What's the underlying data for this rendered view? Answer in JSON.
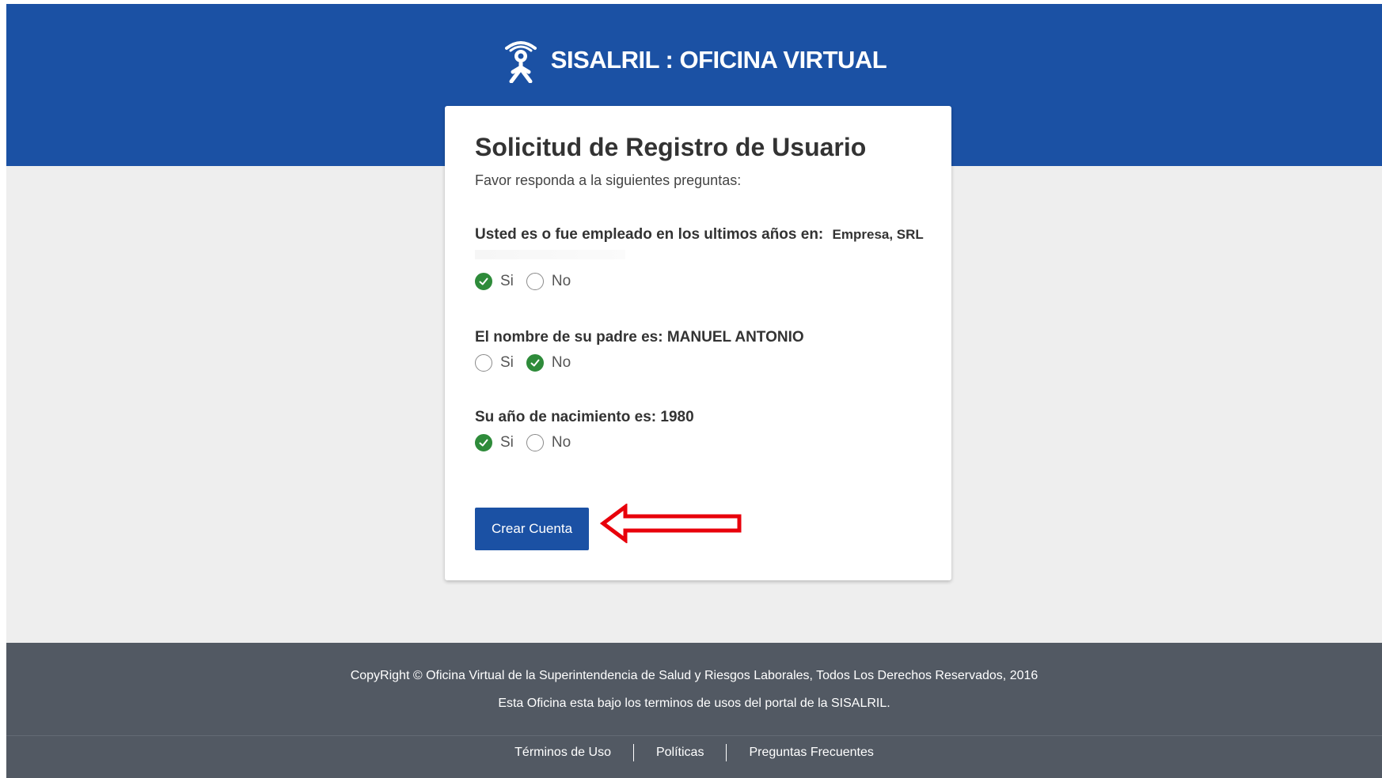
{
  "header": {
    "title": "SISALRIL : OFICINA VIRTUAL",
    "logo_icon": "person-icon",
    "background_color": "#1b51a4"
  },
  "card": {
    "title": "Solicitud de Registro de Usuario",
    "subtitle": "Favor responda a la siguientes preguntas:",
    "questions": [
      {
        "text": "Usted es o fue empleado en los ultimos años en:",
        "value": "Empresa, SRL",
        "options": [
          {
            "label": "Si",
            "checked": true
          },
          {
            "label": "No",
            "checked": false
          }
        ]
      },
      {
        "text": "El nombre de su padre es:",
        "value": "MANUEL ANTONIO",
        "options": [
          {
            "label": "Si",
            "checked": false
          },
          {
            "label": "No",
            "checked": true
          }
        ]
      },
      {
        "text": "Su año de nacimiento es:",
        "value": "1980",
        "options": [
          {
            "label": "Si",
            "checked": true
          },
          {
            "label": "No",
            "checked": false
          }
        ]
      }
    ],
    "submit_label": "Crear Cuenta",
    "check_color": "#2e8b3a"
  },
  "annotation": {
    "arrow_icon": "red-arrow-left-icon",
    "color": "#e8000b"
  },
  "footer": {
    "copyright": "CopyRight © Oficina Virtual de la Superintendencia de Salud y Riesgos Laborales, Todos Los Derechos Reservados, 2016",
    "terms_note": "Esta Oficina esta bajo los terminos de usos del portal de la SISALRIL.",
    "links": [
      "Términos de Uso",
      "Políticas",
      "Preguntas Frecuentes"
    ],
    "background_color": "#525963"
  }
}
